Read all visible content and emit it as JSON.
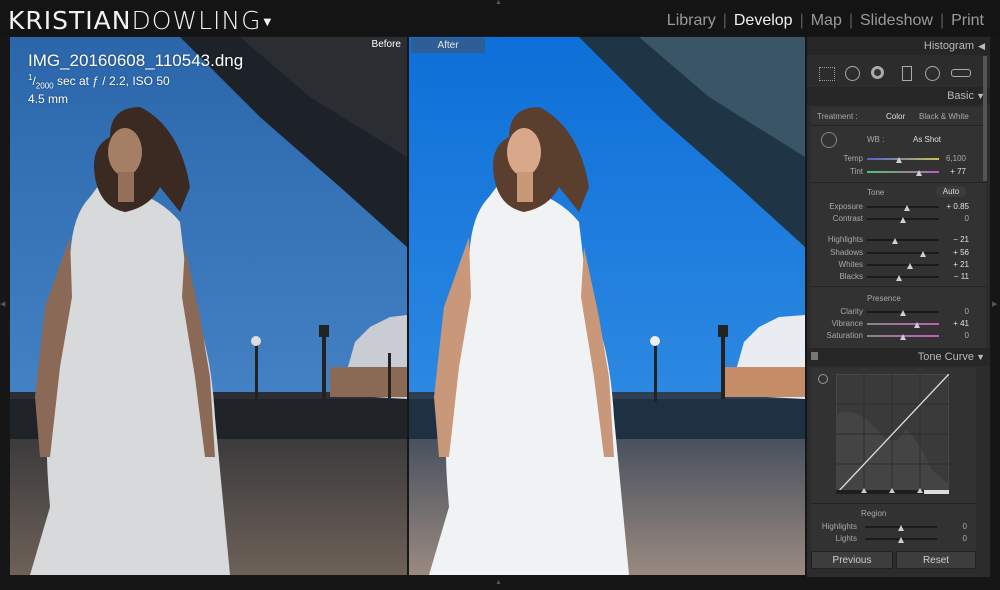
{
  "brand": {
    "part1": "KRISTIAN",
    "part2": "DOWLING"
  },
  "modules": [
    {
      "label": "Library",
      "active": false
    },
    {
      "label": "Develop",
      "active": true
    },
    {
      "label": "Map",
      "active": false
    },
    {
      "label": "Slideshow",
      "active": false
    },
    {
      "label": "Print",
      "active": false
    }
  ],
  "photo": {
    "before_label": "Before",
    "after_label": "After",
    "filename": "IMG_20160608_110543.dng",
    "shutter_num": "1",
    "shutter_den": "2000",
    "exposure_rest": "sec at ƒ / 2.2, ISO 50",
    "focal_length": "4.5 mm"
  },
  "panel": {
    "histogram_label": "Histogram",
    "basic_label": "Basic",
    "treatment_label": "Treatment :",
    "treatment_color": "Color",
    "treatment_bw": "Black & White",
    "wb_label": "WB :",
    "wb_value": "As Shot",
    "temp": {
      "label": "Temp",
      "value": "6,100",
      "fraction": 0.45
    },
    "tint": {
      "label": "Tint",
      "value": "+ 77",
      "fraction": 0.72
    },
    "tone_label": "Tone",
    "auto_label": "Auto",
    "exposure": {
      "label": "Exposure",
      "value": "+ 0.85",
      "fraction": 0.55
    },
    "contrast": {
      "label": "Contrast",
      "value": "0",
      "fraction": 0.5
    },
    "highlights": {
      "label": "Highlights",
      "value": "− 21",
      "fraction": 0.39
    },
    "shadows": {
      "label": "Shadows",
      "value": "+ 56",
      "fraction": 0.78
    },
    "whites": {
      "label": "Whites",
      "value": "+ 21",
      "fraction": 0.6
    },
    "blacks": {
      "label": "Blacks",
      "value": "− 11",
      "fraction": 0.44
    },
    "presence_label": "Presence",
    "clarity": {
      "label": "Clarity",
      "value": "0",
      "fraction": 0.5
    },
    "vibrance": {
      "label": "Vibrance",
      "value": "+ 41",
      "fraction": 0.7
    },
    "saturation": {
      "label": "Saturation",
      "value": "0",
      "fraction": 0.5
    },
    "tone_curve_label": "Tone Curve",
    "region_label": "Region",
    "region_highlights": {
      "label": "Highlights",
      "value": "0",
      "fraction": 0.5
    },
    "region_lights": {
      "label": "Lights",
      "value": "0",
      "fraction": 0.5
    },
    "previous_label": "Previous",
    "reset_label": "Reset"
  },
  "colors": {
    "accent": "#2d5f96",
    "sky_after": "#1677d8",
    "sky_before": "#2f6fb6"
  }
}
